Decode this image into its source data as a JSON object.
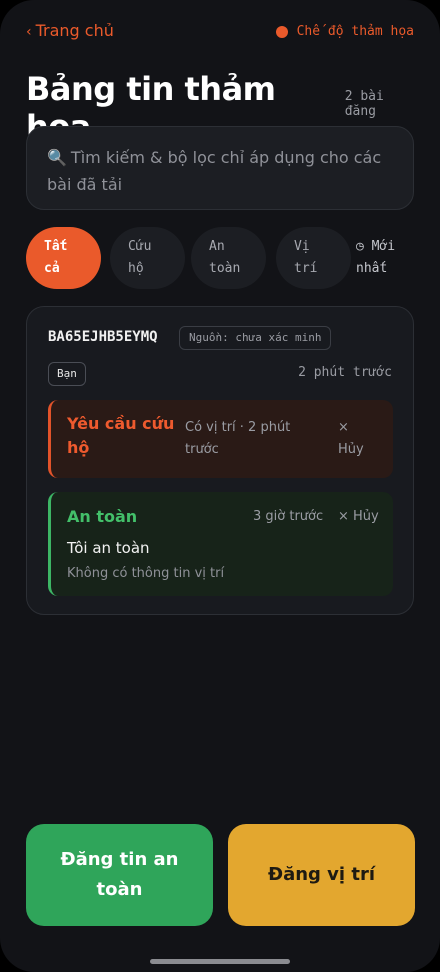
{
  "nav": {
    "back_label": "Trang chủ",
    "mode_label": "Chế độ thảm họa"
  },
  "header": {
    "title": "Bảng tin thảm họa",
    "count": "2 bài đăng"
  },
  "search": {
    "icon": "🔍",
    "placeholder": "Tìm kiếm & bộ lọc chỉ áp dụng cho các bài đã tải"
  },
  "filters": {
    "tabs": [
      {
        "line1": "Tất",
        "line2": "cả"
      },
      {
        "line1": "Cứu",
        "line2": "hộ"
      },
      {
        "line1": "An",
        "line2": "toàn"
      },
      {
        "line1": "Vị",
        "line2": "trí"
      }
    ],
    "sort_icon": "◷",
    "sort_line1": "Mới",
    "sort_line2": "nhất"
  },
  "card": {
    "id": "BA65EJHB5EYMQ",
    "source": "Nguồn: chưa xác minh",
    "you_badge": "Bạn",
    "time": "2 phút trước",
    "posts": [
      {
        "label": "Yêu cầu cứu hộ",
        "meta": "Có vị trí · 2 phút trước",
        "cancel": "× Hủy"
      },
      {
        "label": "An toàn",
        "meta": "3 giờ trước",
        "cancel": "× Hủy",
        "message": "Tôi an toàn",
        "location": "Không có thông tin vị trí"
      }
    ]
  },
  "actions": {
    "post_safe": "Đăng tin an toàn",
    "post_location": "Đăng vị trí"
  },
  "colors": {
    "accent": "#ea5a2b",
    "safe": "#2fa55a",
    "warning": "#e3a72f",
    "background": "#121317"
  }
}
